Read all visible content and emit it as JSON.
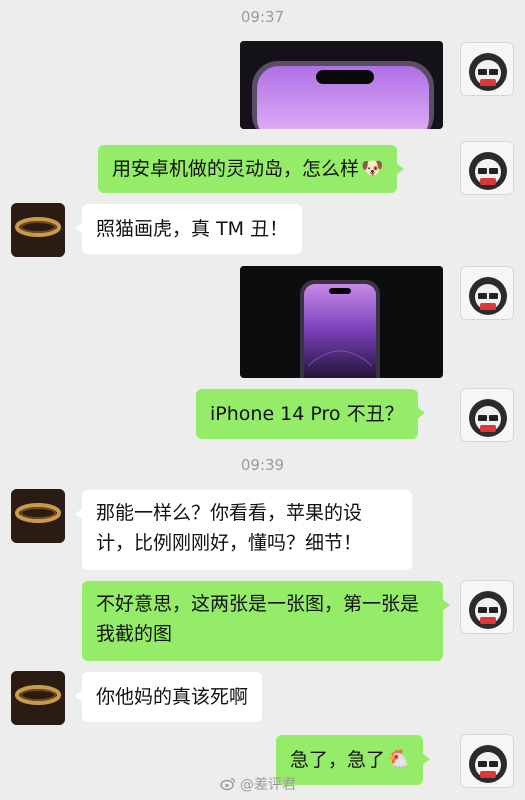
{
  "timestamps": [
    "09:37",
    "09:39"
  ],
  "messages": {
    "m2": "用安卓机做的灵动岛，怎么样",
    "m3": "照猫画虎，真 TM 丑！",
    "m5": "iPhone 14 Pro 不丑？",
    "m6": "那能一样么？你看看，苹果的设计，比例刚刚好，懂吗？细节！",
    "m7": "不好意思，这两张是一张图，第一张是我截的图",
    "m8": "你他妈的真该死啊",
    "m9": "急了，急了"
  },
  "emoji": {
    "m2": "🐶",
    "m9": "🐔"
  },
  "watermark": "@差评君",
  "colors": {
    "background": "#ededed",
    "me_bubble": "#95ec69",
    "other_bubble": "#ffffff"
  }
}
